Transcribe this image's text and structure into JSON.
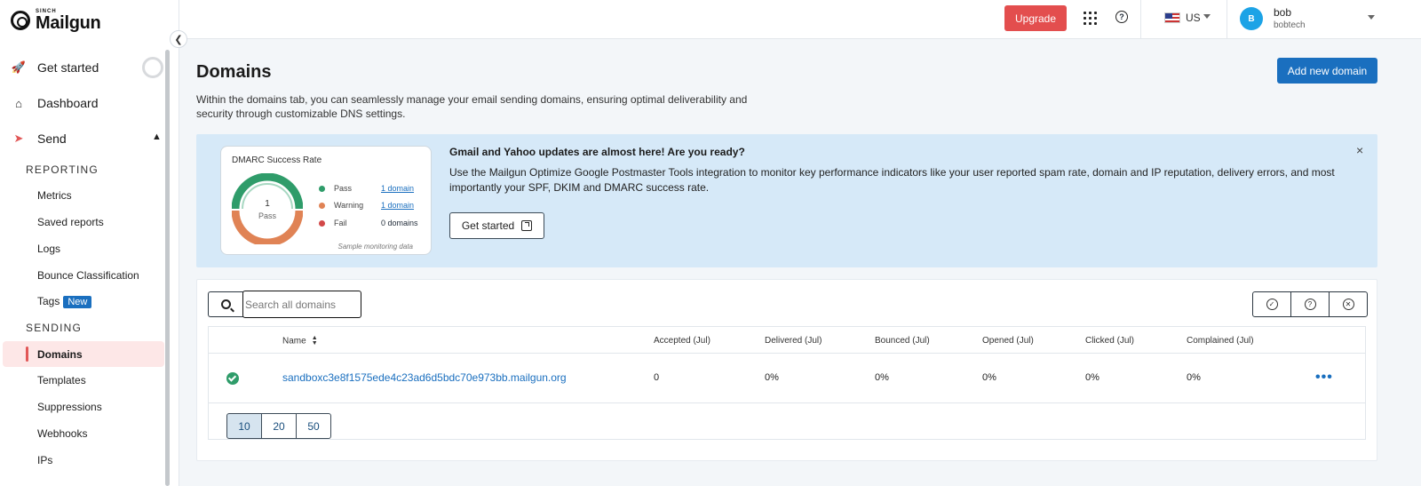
{
  "brand": {
    "small": "SINCH",
    "name": "Mailgun"
  },
  "sidebar": {
    "main_items": [
      {
        "label": "Get started"
      },
      {
        "label": "Dashboard"
      },
      {
        "label": "Send"
      }
    ],
    "reporting_label": "REPORTING",
    "reporting_items": [
      "Metrics",
      "Saved reports",
      "Logs",
      "Bounce Classification",
      "Tags"
    ],
    "tags_badge": "New",
    "sending_label": "SENDING",
    "sending_items": [
      "Domains",
      "Templates",
      "Suppressions",
      "Webhooks",
      "IPs"
    ],
    "active_item": "Domains"
  },
  "topbar": {
    "upgrade_label": "Upgrade",
    "region": "US",
    "user_initial": "B",
    "user_name": "bob",
    "user_org": "bobtech"
  },
  "page": {
    "title": "Domains",
    "description": "Within the domains tab, you can seamlessly manage your email sending domains, ensuring optimal deliverability and security through customizable DNS settings.",
    "add_button": "Add new domain"
  },
  "banner": {
    "card_title": "DMARC Success Rate",
    "gauge_value": "1",
    "gauge_label": "Pass",
    "legend": [
      {
        "label": "Pass",
        "value": "1 domain",
        "link": true,
        "color": "#2f9c6a"
      },
      {
        "label": "Warning",
        "value": "1 domain",
        "link": true,
        "color": "#e08355"
      },
      {
        "label": "Fail",
        "value": "0 domains",
        "link": false,
        "color": "#d24848"
      }
    ],
    "sample_note": "Sample monitoring data",
    "title": "Gmail and Yahoo updates are almost here! Are you ready?",
    "text": "Use the Mailgun Optimize Google Postmaster Tools integration to monitor key performance indicators like your user reported spam rate, domain and IP reputation, delivery errors, and most importantly your SPF, DKIM and DMARC success rate.",
    "cta": "Get started",
    "close": "×"
  },
  "domains": {
    "search_placeholder": "Search all domains",
    "columns": [
      "Name",
      "Accepted (Jul)",
      "Delivered (Jul)",
      "Bounced (Jul)",
      "Opened (Jul)",
      "Clicked (Jul)",
      "Complained (Jul)"
    ],
    "rows": [
      {
        "name": "sandboxc3e8f1575ede4c23ad6d5bdc70e973bb.mailgun.org",
        "accepted": "0",
        "delivered": "0%",
        "bounced": "0%",
        "opened": "0%",
        "clicked": "0%",
        "complained": "0%"
      }
    ],
    "page_sizes": [
      "10",
      "20",
      "50"
    ],
    "selected_page_size": "10"
  },
  "colors": {
    "accent": "#1a6fbf",
    "upgrade": "#e34e4e",
    "banner_bg": "#d6e9f8",
    "active_nav": "#fde7e7"
  }
}
